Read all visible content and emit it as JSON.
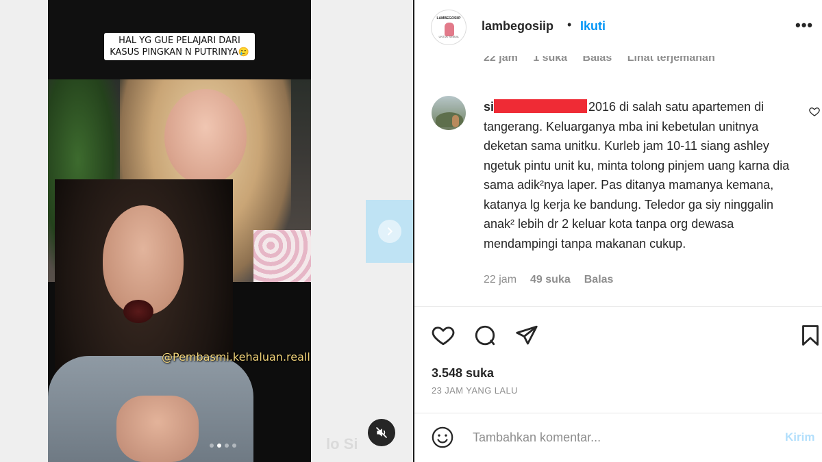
{
  "media": {
    "caption": "HAL YG GUE PELAJARI DARI KASUS PINGKAN N PUTRINYA🥲",
    "watermark": "@Pembasmi.kehaluan.reall",
    "faint_watermark": "lo Si",
    "carousel_dots": 4,
    "carousel_active_index": 1
  },
  "header": {
    "username": "lambegosiip",
    "separator": "•",
    "follow_label": "Ikuti",
    "more_label": "•••",
    "avatar": {
      "logo_text": "LAMBEGOSIIP",
      "logo_sub": "UNTUK SEMUA"
    }
  },
  "previous_comment_meta": {
    "time": "22 jam",
    "likes": "1 suka",
    "reply": "Balas",
    "translate": "Lihat terjemahan"
  },
  "comment": {
    "user_prefix": "si",
    "text": "2016 di salah satu apartemen di tangerang. Keluarganya mba ini kebetulan unitnya deketan sama unitku. Kurleb jam 10-11 siang ashley ngetuk pintu unit ku, minta tolong pinjem uang karna dia sama adik²nya laper. Pas ditanya mamanya kemana, katanya lg kerja ke bandung. Teledor ga siy ninggalin anak² lebih dr 2 keluar kota tanpa org dewasa mendampingi tanpa makanan cukup.",
    "time": "22 jam",
    "likes": "49 suka",
    "reply": "Balas"
  },
  "post": {
    "likes": "3.548 suka",
    "time_ago": "23 JAM YANG LALU"
  },
  "composer": {
    "placeholder": "Tambahkan komentar...",
    "post_label": "Kirim"
  },
  "colors": {
    "accent": "#0095f6",
    "redaction": "#ef2b35",
    "next_arrow_bg": "#bfe3f4",
    "post_disabled": "#b2dffc",
    "watermark": "#f1d37a"
  },
  "icons": {
    "like": "heart-icon",
    "comment": "comment-icon",
    "share": "paper-plane-icon",
    "save": "bookmark-icon",
    "emoji": "smiley-icon",
    "mute": "speaker-muted-icon",
    "next": "chevron-right-icon",
    "comment_like": "heart-outline-icon"
  }
}
